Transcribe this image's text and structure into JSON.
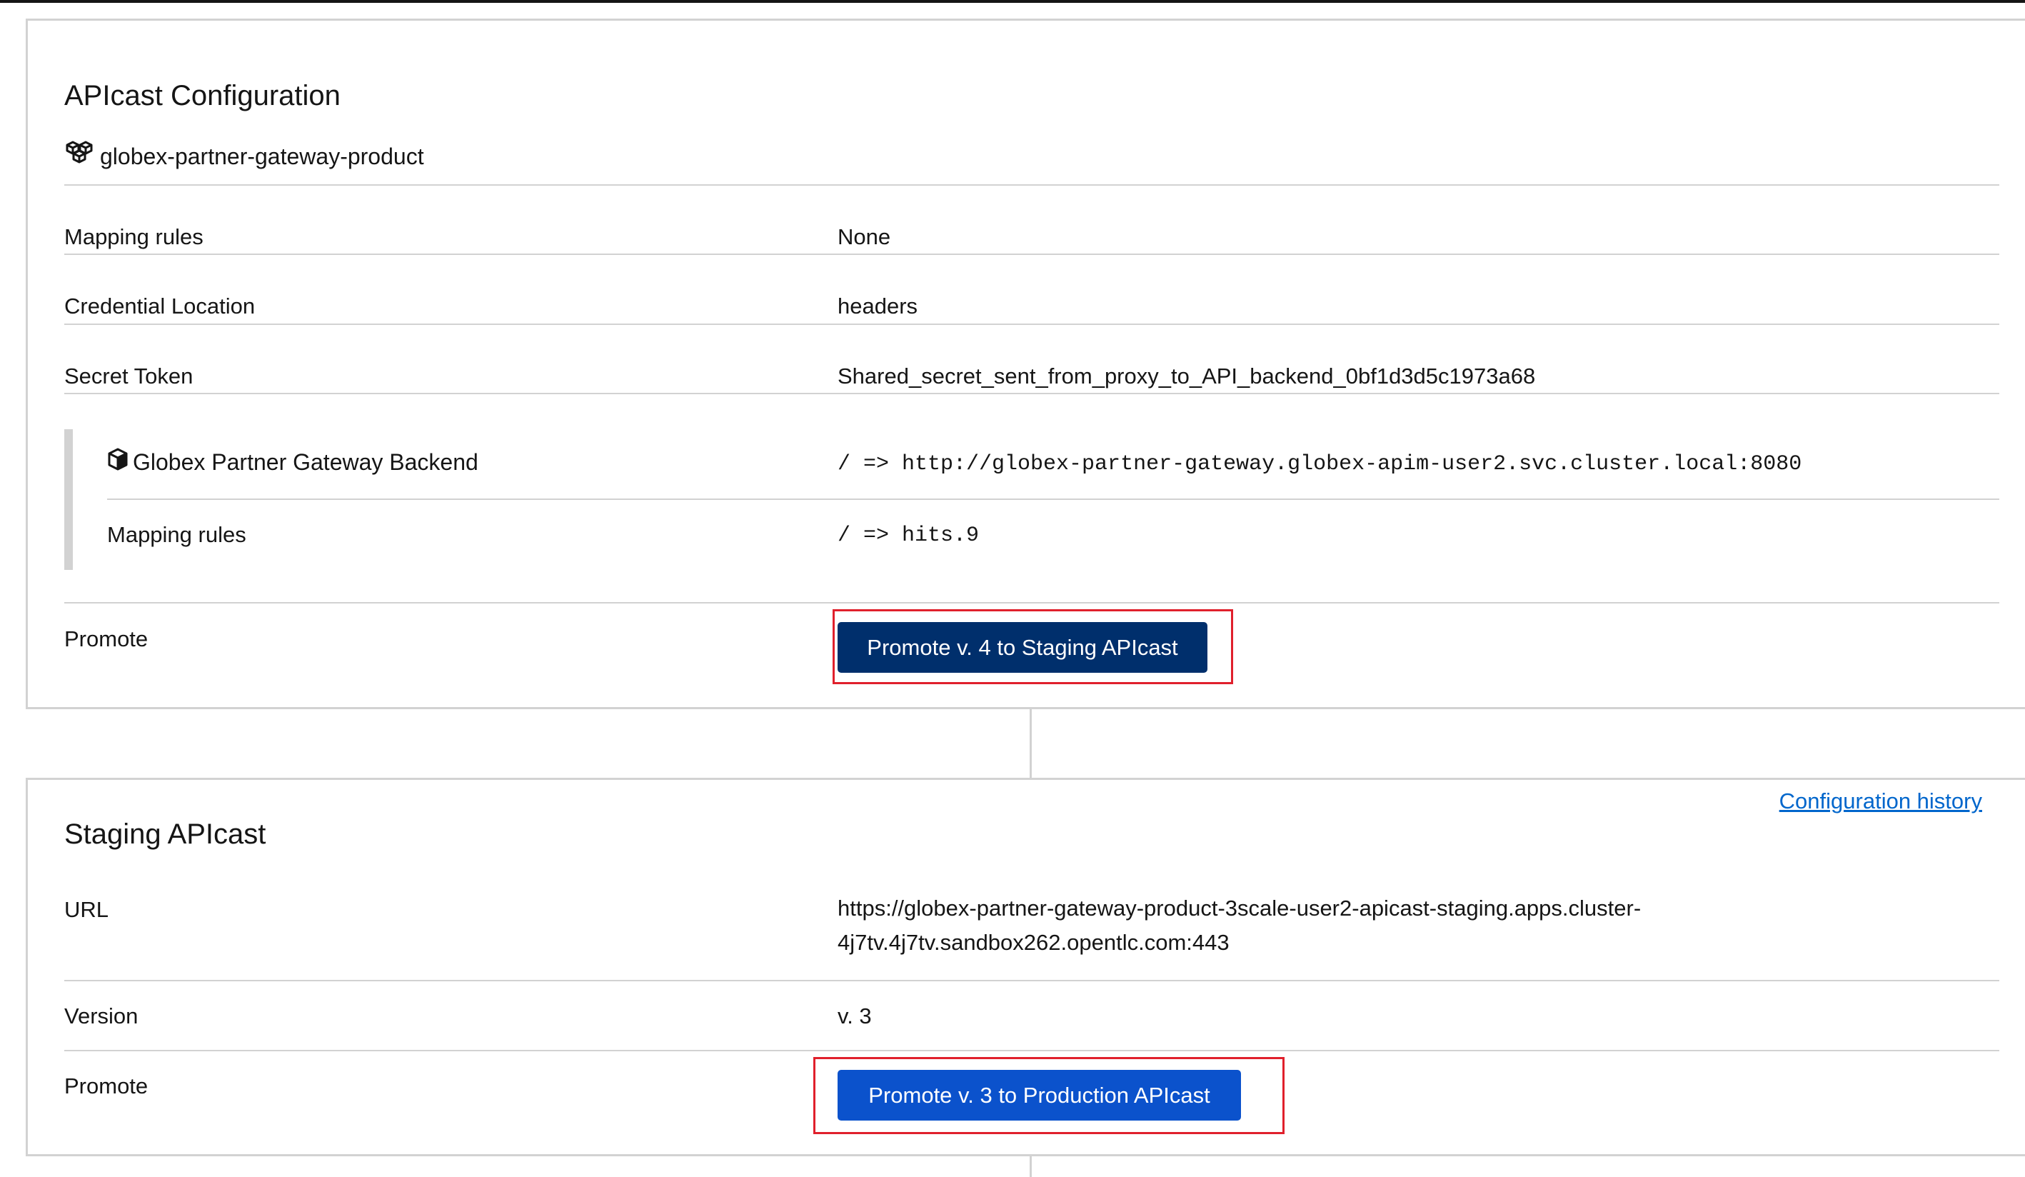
{
  "apicast_config": {
    "title": "APIcast Configuration",
    "product_name": "globex-partner-gateway-product",
    "rows": [
      {
        "label": "Mapping rules",
        "value": "None"
      },
      {
        "label": "Credential Location",
        "value": "headers"
      },
      {
        "label": "Secret Token",
        "value": "Shared_secret_sent_from_proxy_to_API_backend_0bf1d3d5c1973a68"
      }
    ],
    "backend": {
      "name": "Globex Partner Gateway Backend",
      "path": "/ => http://globex-partner-gateway.globex-apim-user2.svc.cluster.local:8080",
      "mapping_label": "Mapping rules",
      "mapping_value": "/ => hits.9"
    },
    "promote_label": "Promote",
    "promote_button": "Promote v. 4 to Staging APIcast"
  },
  "staging": {
    "title": "Staging APIcast",
    "history_link": "Configuration history",
    "url_label": "URL",
    "url_value": "https://globex-partner-gateway-product-3scale-user2-apicast-staging.apps.cluster-4j7tv.4j7tv.sandbox262.opentlc.com:443",
    "version_label": "Version",
    "version_value": "v. 3",
    "promote_label": "Promote",
    "promote_button": "Promote v. 3 to Production APIcast"
  },
  "colors": {
    "promote_staging_bg": "#002f6c",
    "promote_production_bg": "#0b52cc",
    "highlight": "#e0202c",
    "link": "#0066cc",
    "divider": "#d2d2d2"
  },
  "icons": {
    "product": "cubes-icon",
    "backend": "cube-icon"
  }
}
